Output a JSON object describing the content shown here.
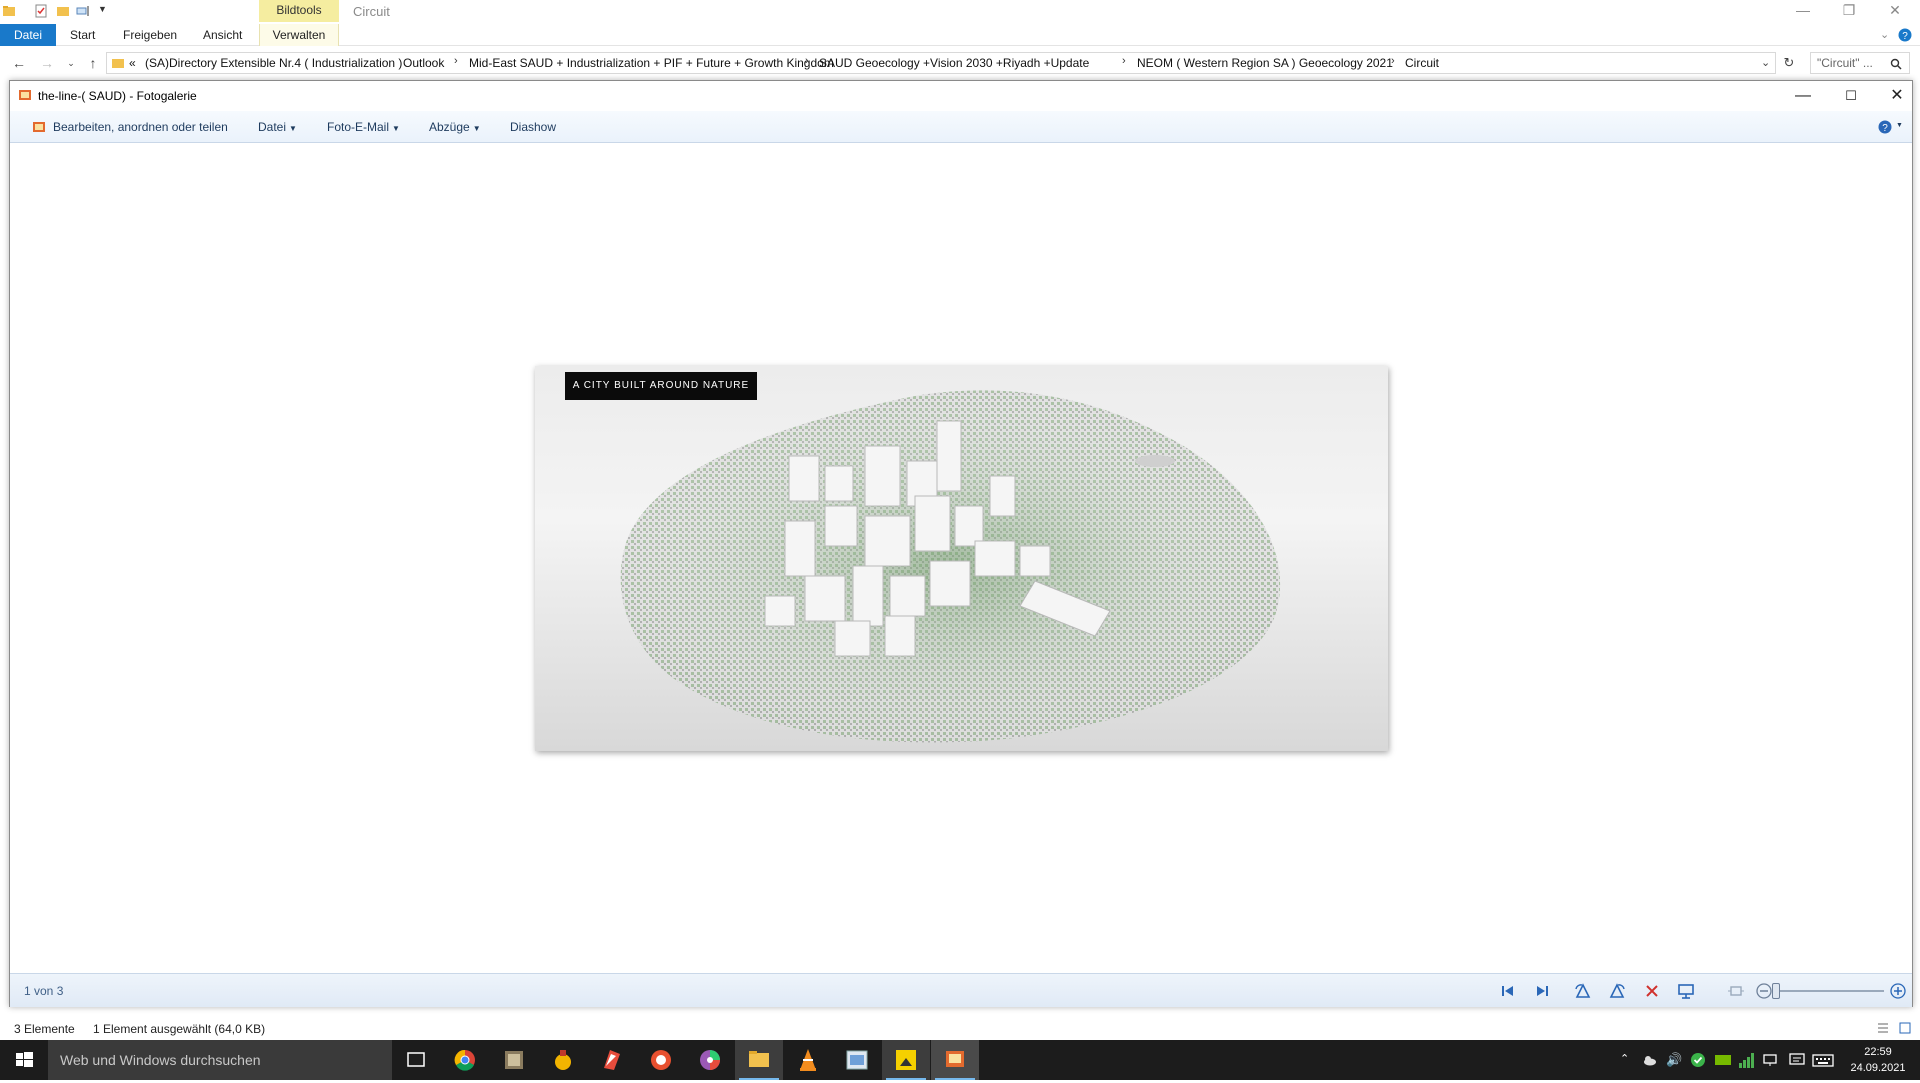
{
  "explorer": {
    "context_tab_group": "Bildtools",
    "window_name": "Circuit",
    "tabs": [
      {
        "label": "Datei"
      },
      {
        "label": "Start"
      },
      {
        "label": "Freigeben"
      },
      {
        "label": "Ansicht"
      },
      {
        "label": "Verwalten"
      }
    ],
    "breadcrumb_prefix": "«",
    "breadcrumbs": [
      "(SA)Directory Extensible Nr.4 ( Industrialization )",
      "Outlook",
      "Mid-East SAUD + Industrialization + PIF + Future + Growth Kingdom",
      "SAUD Geoecology +Vision 2030 +Riyadh +Update",
      "NEOM ( Western Region SA ) Geoecology 2021",
      "Circuit"
    ],
    "search_placeholder": "\"Circuit\" ...",
    "status_items_count": "3 Elemente",
    "status_selection": "1 Element ausgewählt (64,0 KB)"
  },
  "gallery": {
    "title": "the-line-( SAUD) - Fotogalerie",
    "toolbar": {
      "edit": "Bearbeiten, anordnen oder teilen",
      "file": "Datei",
      "photo_email": "Foto-E-Mail",
      "prints": "Abzüge",
      "slideshow": "Diashow"
    },
    "photo_caption": "A CITY BUILT AROUND NATURE",
    "counter": "1 von 3"
  },
  "taskbar": {
    "search_placeholder": "Web und Windows durchsuchen",
    "time": "22:59",
    "date": "24.09.2021"
  },
  "colors": {
    "ribbon_file_tab": "#1979ca",
    "context_tab": "#f5eda0",
    "taskbar": "#1c1c1c",
    "gallery_toolbar_text": "#1e3b5e"
  }
}
